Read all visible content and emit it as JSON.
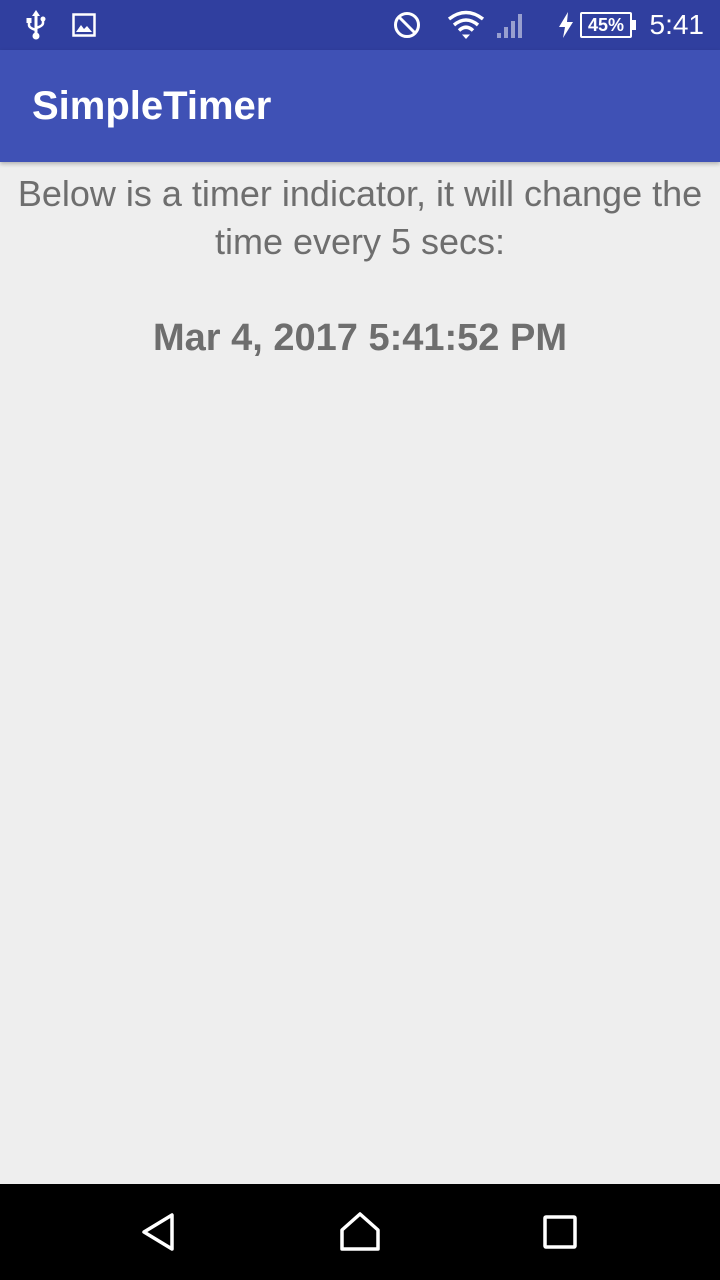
{
  "status_bar": {
    "time": "5:41",
    "battery_percent": "45%",
    "icons": [
      "usb-icon",
      "image-icon",
      "do-not-disturb-icon",
      "wifi-icon",
      "cell-signal-icon",
      "charging-icon",
      "battery-icon"
    ]
  },
  "app_bar": {
    "title": "SimpleTimer"
  },
  "main": {
    "description": "Below is a timer indicator, it will change the time every 5 secs:",
    "timer_value": "Mar 4, 2017 5:41:52 PM"
  },
  "nav_bar": {
    "icons": [
      "back-icon",
      "home-icon",
      "recents-icon"
    ]
  },
  "colors": {
    "status_bar": "#303f9f",
    "app_bar": "#3f51b5",
    "background": "#eeeeee",
    "text": "#6e6e6e"
  }
}
